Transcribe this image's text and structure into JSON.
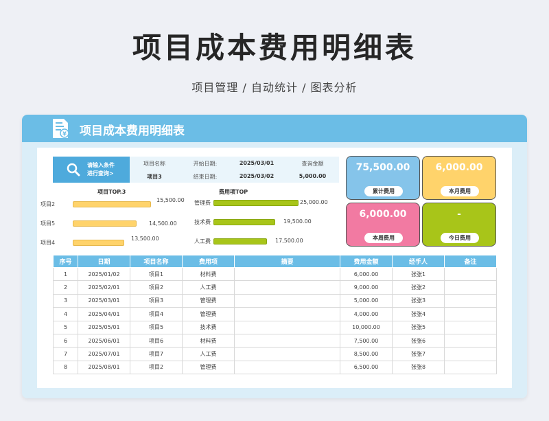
{
  "page": {
    "title": "项目成本费用明细表",
    "subtitle": "项目管理 / 自动统计 / 图表分析"
  },
  "card": {
    "title": "项目成本费用明细表"
  },
  "search": {
    "line1": "请输入条件",
    "line2": "进行查询>"
  },
  "query": {
    "project_label": "项目名称",
    "project_value": "项目3",
    "start_label": "开始日期:",
    "start_value": "2025/03/01",
    "end_label": "结束日期:",
    "end_value": "2025/03/02",
    "amount_label": "查询金额",
    "amount_value": "5,000.00"
  },
  "project_top": {
    "title": "项目TOP.3",
    "items": [
      {
        "label": "项目2",
        "value_text": "15,500.00",
        "value": 15500
      },
      {
        "label": "项目5",
        "value_text": "14,500.00",
        "value": 14500
      },
      {
        "label": "项目4",
        "value_text": "13,500.00",
        "value": 13500
      }
    ]
  },
  "expense_top": {
    "title": "费用项TOP",
    "items": [
      {
        "label": "管理费",
        "value_text": "25,000.00",
        "value": 25000
      },
      {
        "label": "技术费",
        "value_text": "19,500.00",
        "value": 19500
      },
      {
        "label": "人工费",
        "value_text": "17,500.00",
        "value": 17500
      }
    ]
  },
  "tiles": [
    {
      "value": "75,500.00",
      "label": "累计费用",
      "color": "#85c4ea"
    },
    {
      "value": "6,000.00",
      "label": "本月费用",
      "color": "#ffd36b"
    },
    {
      "value": "6,000.00",
      "label": "本周费用",
      "color": "#f27aa2"
    },
    {
      "value": "-",
      "label": "今日费用",
      "color": "#a8c519"
    }
  ],
  "table": {
    "headers": [
      "序号",
      "日期",
      "项目名称",
      "费用项",
      "摘要",
      "费用金额",
      "经手人",
      "备注"
    ],
    "rows": [
      [
        "1",
        "2025/01/02",
        "项目1",
        "材料费",
        "",
        "6,000.00",
        "张张1",
        ""
      ],
      [
        "2",
        "2025/02/01",
        "项目2",
        "人工费",
        "",
        "9,000.00",
        "张张2",
        ""
      ],
      [
        "3",
        "2025/03/01",
        "项目3",
        "管理费",
        "",
        "5,000.00",
        "张张3",
        ""
      ],
      [
        "4",
        "2025/04/01",
        "项目4",
        "管理费",
        "",
        "4,000.00",
        "张张4",
        ""
      ],
      [
        "5",
        "2025/05/01",
        "项目5",
        "技术费",
        "",
        "10,000.00",
        "张张5",
        ""
      ],
      [
        "6",
        "2025/06/01",
        "项目6",
        "材料费",
        "",
        "7,500.00",
        "张张6",
        ""
      ],
      [
        "7",
        "2025/07/01",
        "项目7",
        "人工费",
        "",
        "8,500.00",
        "张张7",
        ""
      ],
      [
        "8",
        "2025/08/01",
        "项目2",
        "管理费",
        "",
        "6,500.00",
        "张张8",
        ""
      ]
    ]
  }
}
